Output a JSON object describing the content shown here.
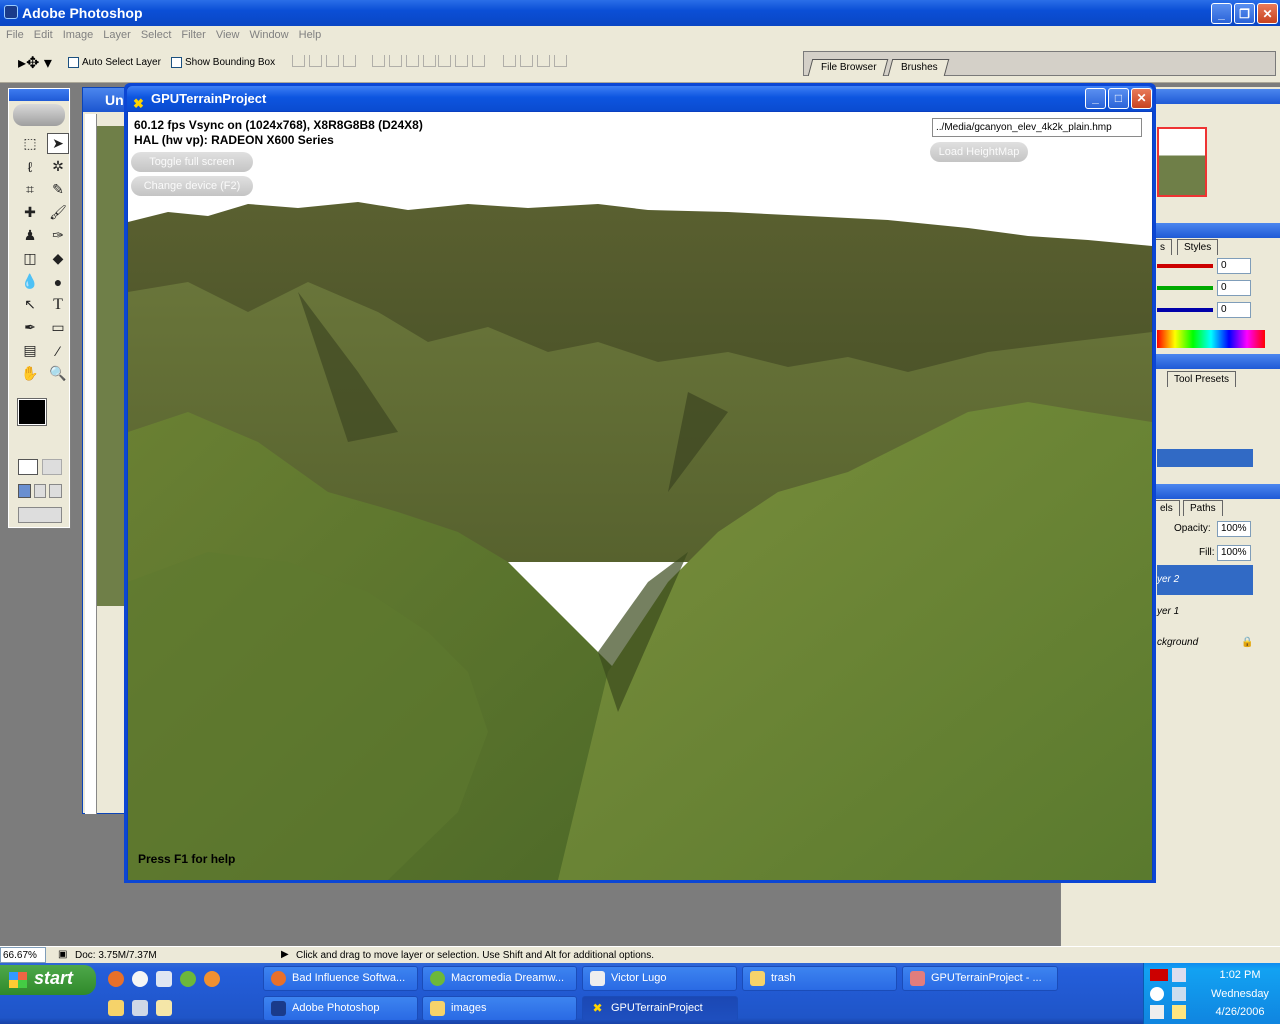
{
  "photoshop": {
    "title": "Adobe Photoshop",
    "menu": [
      "File",
      "Edit",
      "Image",
      "Layer",
      "Select",
      "Filter",
      "View",
      "Window",
      "Help"
    ],
    "options": {
      "auto_select_layer": "Auto Select Layer",
      "show_bounding_box": "Show Bounding Box"
    },
    "palette_well_tabs": [
      "File Browser",
      "Brushes"
    ],
    "doc_window_title": "Un",
    "status": {
      "zoom": "66.67%",
      "doc": "Doc: 3.75M/7.37M",
      "hint": "Click and drag to move layer or selection.  Use Shift and Alt for additional options."
    },
    "palettes": {
      "color_tabs": [
        "s",
        "Styles"
      ],
      "color_values": [
        "0",
        "0",
        "0"
      ],
      "history_tabs": [
        "Tool Presets"
      ],
      "layers_tabs": [
        "els",
        "Paths"
      ],
      "opacity_label": "Opacity:",
      "opacity_value": "100%",
      "fill_label": "Fill:",
      "fill_value": "100%",
      "layers": [
        "yer 2",
        "yer 1",
        "ckground"
      ]
    }
  },
  "gpu_window": {
    "title": "GPUTerrainProject",
    "stats_line1": "60.12 fps Vsync on (1024x768), X8R8G8B8 (D24X8)",
    "stats_line2": "HAL (hw vp): RADEON X600 Series",
    "btn_toggle": "Toggle full screen",
    "btn_change_device": "Change device (F2)",
    "heightmap_path": "../Media/gcanyon_elev_4k2k_plain.hmp",
    "btn_load_heightmap": "Load HeightMap",
    "help": "Press F1 for help"
  },
  "taskbar": {
    "start": "start",
    "row1": [
      "Bad Influence Softwa...",
      "Macromedia Dreamw...",
      "Victor Lugo",
      "trash",
      "GPUTerrainProject - ..."
    ],
    "row2": [
      "Adobe Photoshop",
      "images",
      "GPUTerrainProject"
    ],
    "clock": {
      "time": "1:02 PM",
      "day": "Wednesday",
      "date": "4/26/2006"
    }
  },
  "colors": {
    "xp_blue": "#0b46d4",
    "grass": "#6b7a35",
    "task_green": "#3c9a36"
  }
}
